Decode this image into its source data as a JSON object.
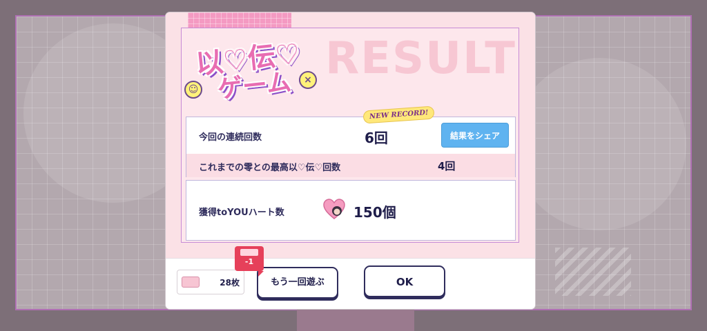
{
  "background": {
    "frame_color": "#b070b4"
  },
  "header": {
    "watermark": "RESULT",
    "logo_line1": "以♡伝♡",
    "logo_line2": "ゲーム"
  },
  "stats": {
    "current_streak_label": "今回の連続回数",
    "current_streak_value": "6回",
    "new_record_badge": "NEW RECORD!",
    "share_button_label": "結果をシェア",
    "best_label": "これまでの零との最高以♡伝♡回数",
    "best_value": "4回"
  },
  "hearts": {
    "label": "獲得toYOUハート数",
    "value": "150個"
  },
  "footer": {
    "ticket_count": "28枚",
    "cost_badge": "-1",
    "play_again_label": "もう一回遊ぶ",
    "ok_label": "OK"
  },
  "colors": {
    "accent_pink": "#e86db2",
    "share_blue": "#5fb3f0",
    "badge_red": "#e6405a",
    "text_navy": "#1f1d4a"
  }
}
